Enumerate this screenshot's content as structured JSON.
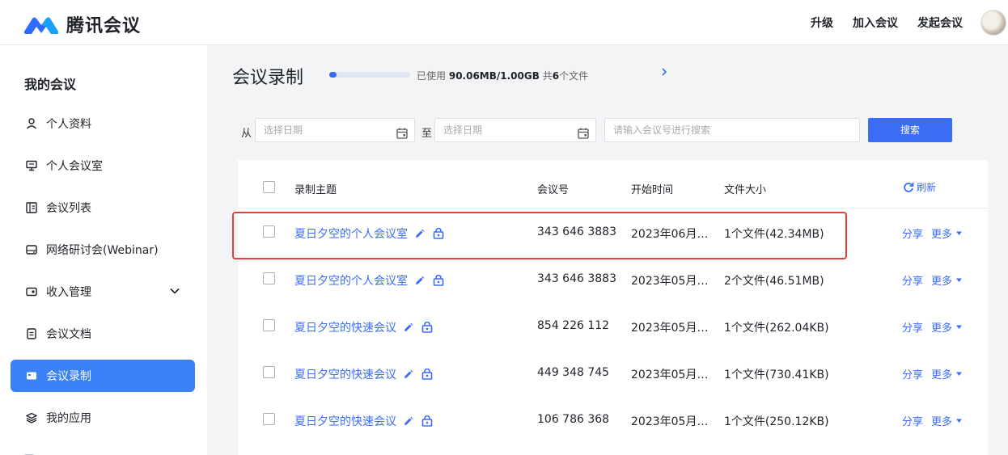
{
  "app": {
    "brand": "腾讯会议"
  },
  "top_nav": {
    "upgrade": "升级",
    "join": "加入会议",
    "start": "发起会议"
  },
  "sidebar": {
    "title": "我的会议",
    "items": [
      {
        "label": "个人资料",
        "icon": "person-icon"
      },
      {
        "label": "个人会议室",
        "icon": "room-icon"
      },
      {
        "label": "会议列表",
        "icon": "list-icon"
      },
      {
        "label": "网络研讨会(Webinar)",
        "icon": "webinar-icon"
      },
      {
        "label": "收入管理",
        "icon": "wallet-icon"
      },
      {
        "label": "会议文档",
        "icon": "document-icon"
      },
      {
        "label": "会议录制",
        "icon": "recording-icon",
        "active": true
      },
      {
        "label": "我的应用",
        "icon": "layers-icon"
      }
    ]
  },
  "main": {
    "title": "会议录制",
    "usage": {
      "prefix": "已使用",
      "used": "90.06MB/1.00GB",
      "mid": "共",
      "count": "6",
      "suffix": "个文件",
      "fraction": 0.09
    },
    "filter": {
      "from_label": "从",
      "to_label": "至",
      "date_placeholder": "选择日期",
      "search_placeholder": "请输入会议号进行搜索",
      "search_button": "搜索"
    },
    "table": {
      "headers": {
        "topic": "录制主题",
        "meeting_id": "会议号",
        "start_time": "开始时间",
        "file_size": "文件大小",
        "refresh": "刷新"
      },
      "share_label": "分享",
      "more_label": "更多",
      "rows": [
        {
          "topic": "夏日夕空的个人会议室",
          "meeting_id": "343 646 3883",
          "start_time": "2023年06月…",
          "file_size": "1个文件(42.34MB)"
        },
        {
          "topic": "夏日夕空的个人会议室",
          "meeting_id": "343 646 3883",
          "start_time": "2023年05月…",
          "file_size": "2个文件(46.51MB)"
        },
        {
          "topic": "夏日夕空的快速会议",
          "meeting_id": "854 226 112",
          "start_time": "2023年05月…",
          "file_size": "1个文件(262.04KB)"
        },
        {
          "topic": "夏日夕空的快速会议",
          "meeting_id": "449 348 745",
          "start_time": "2023年05月…",
          "file_size": "1个文件(730.41KB)"
        },
        {
          "topic": "夏日夕空的快速会议",
          "meeting_id": "106 786 368",
          "start_time": "2023年05月…",
          "file_size": "1个文件(250.12KB)"
        }
      ]
    }
  },
  "colors": {
    "accent": "#3b6cf6",
    "highlight": "#e0403b",
    "active_bg": "#3b82f6"
  }
}
